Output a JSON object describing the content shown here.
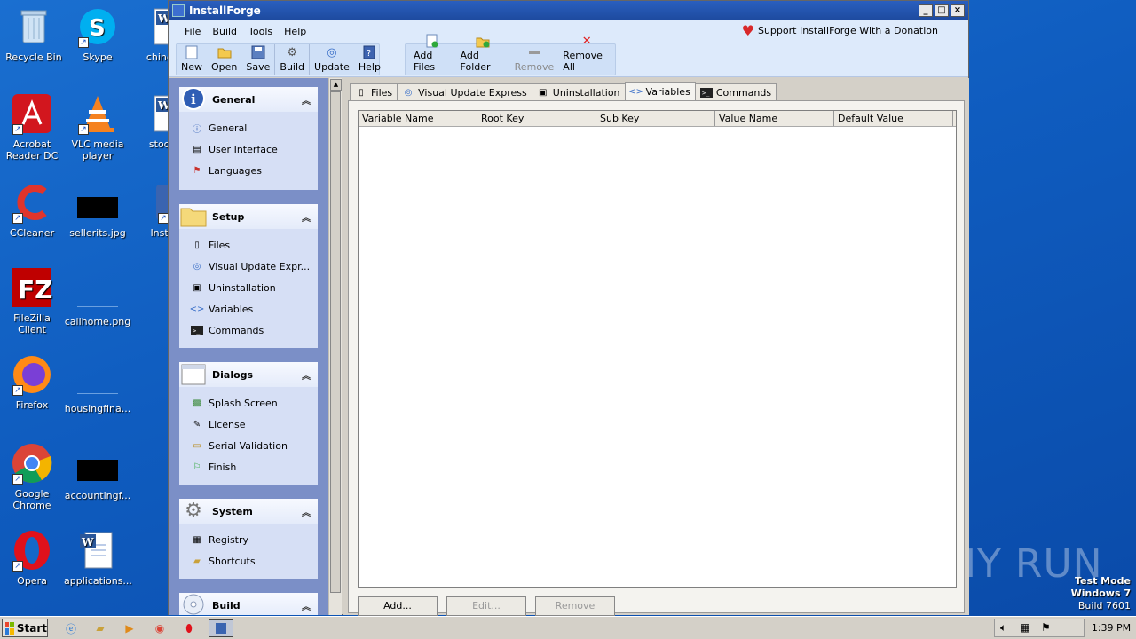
{
  "desktop": {
    "icons": [
      {
        "label": "Recycle Bin",
        "icon": "recycle-bin-icon"
      },
      {
        "label": "Acrobat Reader DC",
        "icon": "acrobat-icon"
      },
      {
        "label": "CCleaner",
        "icon": "ccleaner-icon"
      },
      {
        "label": "FileZilla Client",
        "icon": "filezilla-icon"
      },
      {
        "label": "Firefox",
        "icon": "firefox-icon"
      },
      {
        "label": "Google Chrome",
        "icon": "chrome-icon"
      },
      {
        "label": "Opera",
        "icon": "opera-icon"
      },
      {
        "label": "Skype",
        "icon": "skype-icon"
      },
      {
        "label": "VLC media player",
        "icon": "vlc-icon"
      },
      {
        "label": "sellerits.jpg",
        "icon": "image-file-icon"
      },
      {
        "label": "callhome.png",
        "icon": "image-file-icon"
      },
      {
        "label": "housingfina...",
        "icon": "image-file-icon"
      },
      {
        "label": "accountingf...",
        "icon": "image-file-icon"
      },
      {
        "label": "applications...",
        "icon": "word-doc-icon"
      },
      {
        "label": "chinese",
        "icon": "word-doc-icon"
      },
      {
        "label": "stockg",
        "icon": "word-doc-icon"
      },
      {
        "label": "Install",
        "icon": "installforge-icon"
      }
    ],
    "test_mode": {
      "line1": "Test Mode",
      "line2": "Windows 7",
      "line3": "Build 7601"
    },
    "watermark": "ANY RUN"
  },
  "window": {
    "title": "InstallForge",
    "controls": {
      "minimize": "_",
      "maximize": "□",
      "close": "×"
    },
    "menu": [
      "File",
      "Build",
      "Tools",
      "Help"
    ],
    "donate_label": "Support InstallForge With a Donation",
    "toolbar": {
      "file_group": [
        {
          "label": "New",
          "icon": "new-file-icon",
          "enabled": true
        },
        {
          "label": "Open",
          "icon": "open-folder-icon",
          "enabled": true
        },
        {
          "label": "Save",
          "icon": "save-icon",
          "enabled": true
        },
        {
          "label": "Build",
          "icon": "build-gear-icon",
          "enabled": true
        },
        {
          "label": "Update",
          "icon": "update-icon",
          "enabled": true
        },
        {
          "label": "Help",
          "icon": "help-book-icon",
          "enabled": true
        }
      ],
      "edit_group": [
        {
          "label": "Add Files",
          "icon": "add-files-icon",
          "enabled": true
        },
        {
          "label": "Add Folder",
          "icon": "add-folder-icon",
          "enabled": true
        },
        {
          "label": "Remove",
          "icon": "remove-icon",
          "enabled": false
        },
        {
          "label": "Remove All",
          "icon": "remove-all-icon",
          "enabled": true
        }
      ]
    }
  },
  "sidebar": {
    "panels": [
      {
        "title": "General",
        "items": [
          "General",
          "User Interface",
          "Languages"
        ]
      },
      {
        "title": "Setup",
        "items": [
          "Files",
          "Visual Update Expr...",
          "Uninstallation",
          "Variables",
          "Commands"
        ]
      },
      {
        "title": "Dialogs",
        "items": [
          "Splash Screen",
          "License",
          "Serial Validation",
          "Finish"
        ]
      },
      {
        "title": "System",
        "items": [
          "Registry",
          "Shortcuts"
        ]
      },
      {
        "title": "Build",
        "items": []
      }
    ]
  },
  "main": {
    "tabs": [
      "Files",
      "Visual Update Express",
      "Uninstallation",
      "Variables",
      "Commands"
    ],
    "active_tab": "Variables",
    "columns": [
      "Variable Name",
      "Root Key",
      "Sub Key",
      "Value Name",
      "Default Value"
    ],
    "buttons": {
      "add": "Add...",
      "edit": "Edit...",
      "remove": "Remove"
    }
  },
  "taskbar": {
    "start_label": "Start",
    "clock": "1:39 PM"
  },
  "colors": {
    "desktop": "#0f5cbf",
    "sidebar_bg": "#7b8fc7",
    "titlebar": "#1d4a9e",
    "ribbon_bg": "#ddeafb"
  }
}
